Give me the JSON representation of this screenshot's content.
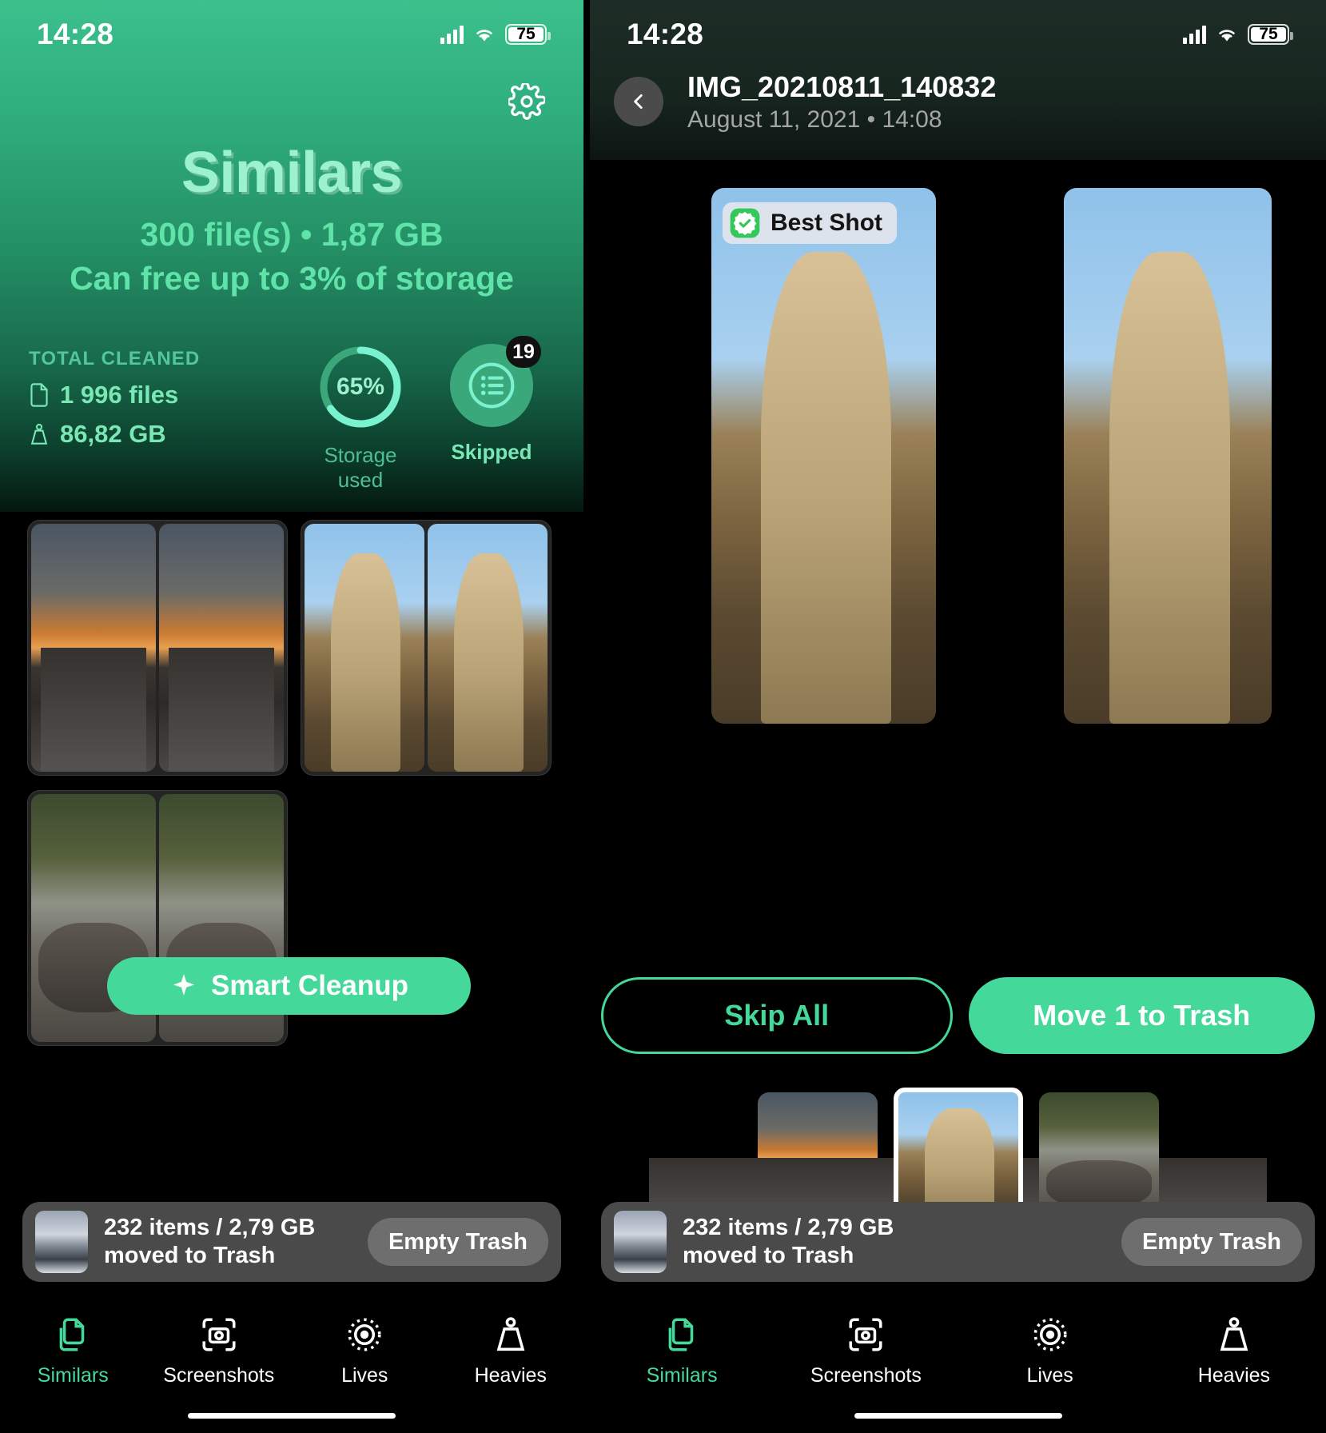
{
  "status_bar": {
    "time": "14:28",
    "battery": "75",
    "signal_icon": "cellular-signal-icon",
    "wifi_icon": "wifi-icon"
  },
  "left": {
    "settings_icon": "gear-icon",
    "app_title": "Similars",
    "summary_line1": "300 file(s) • 1,87 GB",
    "summary_line2": "Can free up to 3% of storage",
    "total_cleaned": {
      "title": "TOTAL CLEANED",
      "files": "1 996 files",
      "size": "86,82 GB",
      "files_icon": "document-icon",
      "size_icon": "weight-icon"
    },
    "storage": {
      "percent": "65%",
      "percent_value": 65,
      "label": "Storage used"
    },
    "skipped": {
      "count": "19",
      "label": "Skipped",
      "icon": "list-icon"
    },
    "smart_cleanup": {
      "label": "Smart Cleanup",
      "icon": "sparkle-icon"
    }
  },
  "right": {
    "back_icon": "chevron-left-icon",
    "photo_title": "IMG_20210811_140832",
    "photo_subtitle": "August 11, 2021 • 14:08",
    "best_shot": {
      "label": "Best Shot",
      "icon": "verified-seal-icon"
    },
    "skip_all": "Skip All",
    "move_to_trash": "Move 1 to Trash",
    "shutter": "shutter-button"
  },
  "trash": {
    "text_line1": "232 items / 2,79 GB",
    "text_line2": "moved to Trash",
    "button": "Empty Trash",
    "thumb": "snow-mountain-thumbnail"
  },
  "tabs": [
    {
      "label": "Similars",
      "icon": "duplicate-files-icon",
      "active": true
    },
    {
      "label": "Screenshots",
      "icon": "screenshot-camera-icon",
      "active": false
    },
    {
      "label": "Lives",
      "icon": "live-photo-icon",
      "active": false
    },
    {
      "label": "Heavies",
      "icon": "weight-icon",
      "active": false
    }
  ],
  "colors": {
    "accent": "#44d99a",
    "title": "#9cf2cd",
    "hero_top": "#3cc08c",
    "dark": "#000000"
  }
}
